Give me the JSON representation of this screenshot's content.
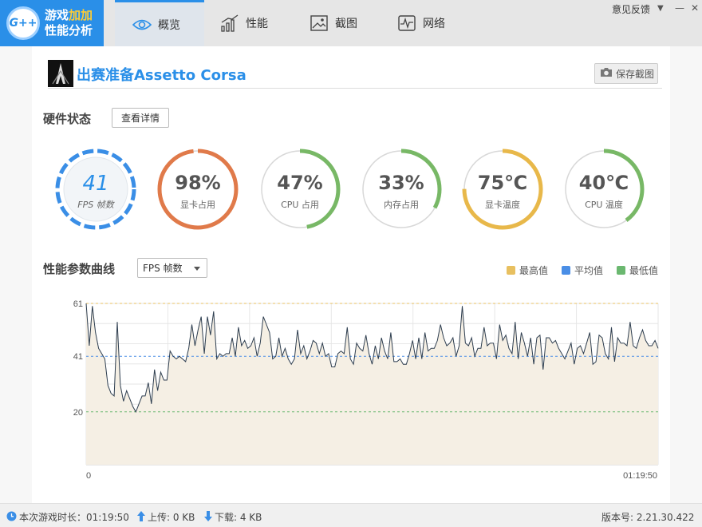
{
  "app": {
    "logo_badge": "G++",
    "logo_line1_a": "游戏",
    "logo_line1_b": "加加",
    "logo_line2": "性能分析"
  },
  "tabs": [
    {
      "label": "概览",
      "icon": "eye-icon",
      "active": true
    },
    {
      "label": "性能",
      "icon": "bar-chart-icon",
      "active": false
    },
    {
      "label": "截图",
      "icon": "image-icon",
      "active": false
    },
    {
      "label": "网络",
      "icon": "pulse-icon",
      "active": false
    }
  ],
  "window": {
    "feedback_label": "意见反馈",
    "menu_icon": "▼",
    "minimize_icon": "—",
    "close_icon": "✕"
  },
  "game": {
    "title": "出赛准备Assetto Corsa",
    "screenshot_button": "保存截图"
  },
  "hardware": {
    "title": "硬件状态",
    "detail_button": "查看详情",
    "gauges": [
      {
        "value": "41",
        "label": "FPS 帧数",
        "fraction": 1.0,
        "color": "#3a8ee6"
      },
      {
        "value": "98%",
        "label": "显卡占用",
        "fraction": 0.98,
        "color": "#e07a4a"
      },
      {
        "value": "47%",
        "label": "CPU 占用",
        "fraction": 0.47,
        "color": "#78b866"
      },
      {
        "value": "33%",
        "label": "内存占用",
        "fraction": 0.33,
        "color": "#78b866"
      },
      {
        "value": "75℃",
        "label": "显卡温度",
        "fraction": 0.75,
        "color": "#e8b84a"
      },
      {
        "value": "40℃",
        "label": "CPU 温度",
        "fraction": 0.4,
        "color": "#78b866"
      }
    ]
  },
  "curve": {
    "title": "性能参数曲线",
    "select_value": "FPS 帧数",
    "legend": [
      {
        "label": "最高值",
        "color": "#e8c060"
      },
      {
        "label": "平均值",
        "color": "#4a8ee6"
      },
      {
        "label": "最低值",
        "color": "#6bb870"
      }
    ]
  },
  "chart_data": {
    "type": "area",
    "ylim": [
      0,
      61
    ],
    "yticks": [
      "61",
      "41",
      "20"
    ],
    "x_start_label": "0",
    "x_end_label": "01:19:50",
    "max": 61,
    "avg": 41,
    "min": 20,
    "values": [
      61,
      45,
      60,
      50,
      44,
      42,
      40,
      30,
      27,
      26,
      54,
      30,
      24,
      28,
      25,
      22,
      20,
      23,
      26,
      26,
      31,
      23,
      36,
      28,
      35,
      32,
      32,
      43,
      41,
      40,
      41,
      40,
      39,
      44,
      53,
      45,
      51,
      56,
      42,
      56,
      49,
      58,
      40,
      42,
      41,
      42,
      42,
      48,
      41,
      52,
      45,
      47,
      44,
      45,
      48,
      41,
      46,
      56,
      53,
      50,
      40,
      41,
      48,
      41,
      44,
      40,
      38,
      40,
      51,
      42,
      45,
      40,
      43,
      47,
      46,
      42,
      46,
      41,
      42,
      37,
      37,
      42,
      43,
      42,
      52,
      40,
      38,
      46,
      44,
      43,
      49,
      42,
      38,
      45,
      40,
      48,
      43,
      40,
      50,
      39,
      39,
      40,
      38,
      38,
      42,
      47,
      40,
      48,
      40,
      50,
      43,
      44,
      44,
      47,
      53,
      48,
      45,
      46,
      48,
      41,
      45,
      60,
      46,
      45,
      48,
      41,
      44,
      44,
      52,
      45,
      46,
      46,
      40,
      53,
      47,
      49,
      44,
      42,
      54,
      40,
      50,
      46,
      41,
      48,
      38,
      48,
      49,
      36,
      48,
      48,
      46,
      47,
      44,
      42,
      40,
      43,
      46,
      38,
      44,
      45,
      42,
      46,
      50,
      38,
      39,
      49,
      48,
      42,
      40,
      52,
      39,
      48,
      46,
      46,
      45,
      54,
      45,
      44,
      48,
      51,
      47,
      45,
      45,
      47,
      44
    ],
    "grid": true
  },
  "status": {
    "duration": "本次游戏时长：01:19:50",
    "upload": "上传: 0 KB",
    "download": "下载: 4 KB",
    "version": "版本号:  2.21.30.422"
  }
}
